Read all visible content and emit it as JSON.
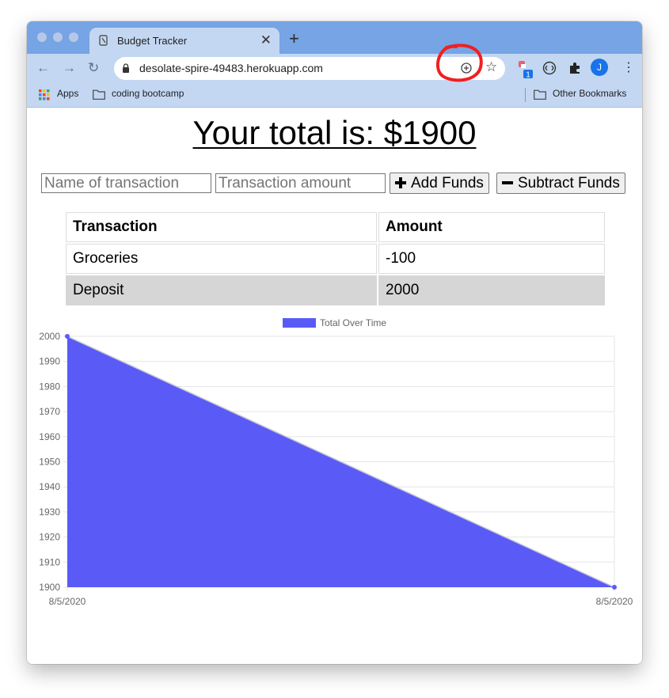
{
  "browser": {
    "tab_title": "Budget Tracker",
    "url": "desolate-spire-49483.herokuapp.com",
    "profile_initial": "J",
    "extension_badge": "1",
    "bookmarks": {
      "apps": "Apps",
      "coding": "coding bootcamp",
      "other": "Other Bookmarks"
    }
  },
  "page": {
    "total_text": "Your total is: $1900",
    "name_placeholder": "Name of transaction",
    "amount_placeholder": "Transaction amount",
    "add_label": "Add Funds",
    "subtract_label": "Subtract Funds",
    "table": {
      "headers": [
        "Transaction",
        "Amount"
      ],
      "rows": [
        [
          "Groceries",
          "-100"
        ],
        [
          "Deposit",
          "2000"
        ]
      ]
    }
  },
  "colors": {
    "accent_fill": "#5a5bf7",
    "annotation_circle": "#f21f1f",
    "profile": "#1a73e8"
  },
  "chart_data": {
    "type": "area",
    "x": [
      "8/5/2020",
      "8/5/2020"
    ],
    "series": [
      {
        "name": "Total Over Time",
        "values": [
          2000,
          1900
        ]
      }
    ],
    "yticks": [
      2000,
      1990,
      1980,
      1970,
      1960,
      1950,
      1940,
      1930,
      1920,
      1910,
      1900
    ],
    "ylim": [
      1900,
      2000
    ],
    "grid": true,
    "legend": "top-center"
  }
}
